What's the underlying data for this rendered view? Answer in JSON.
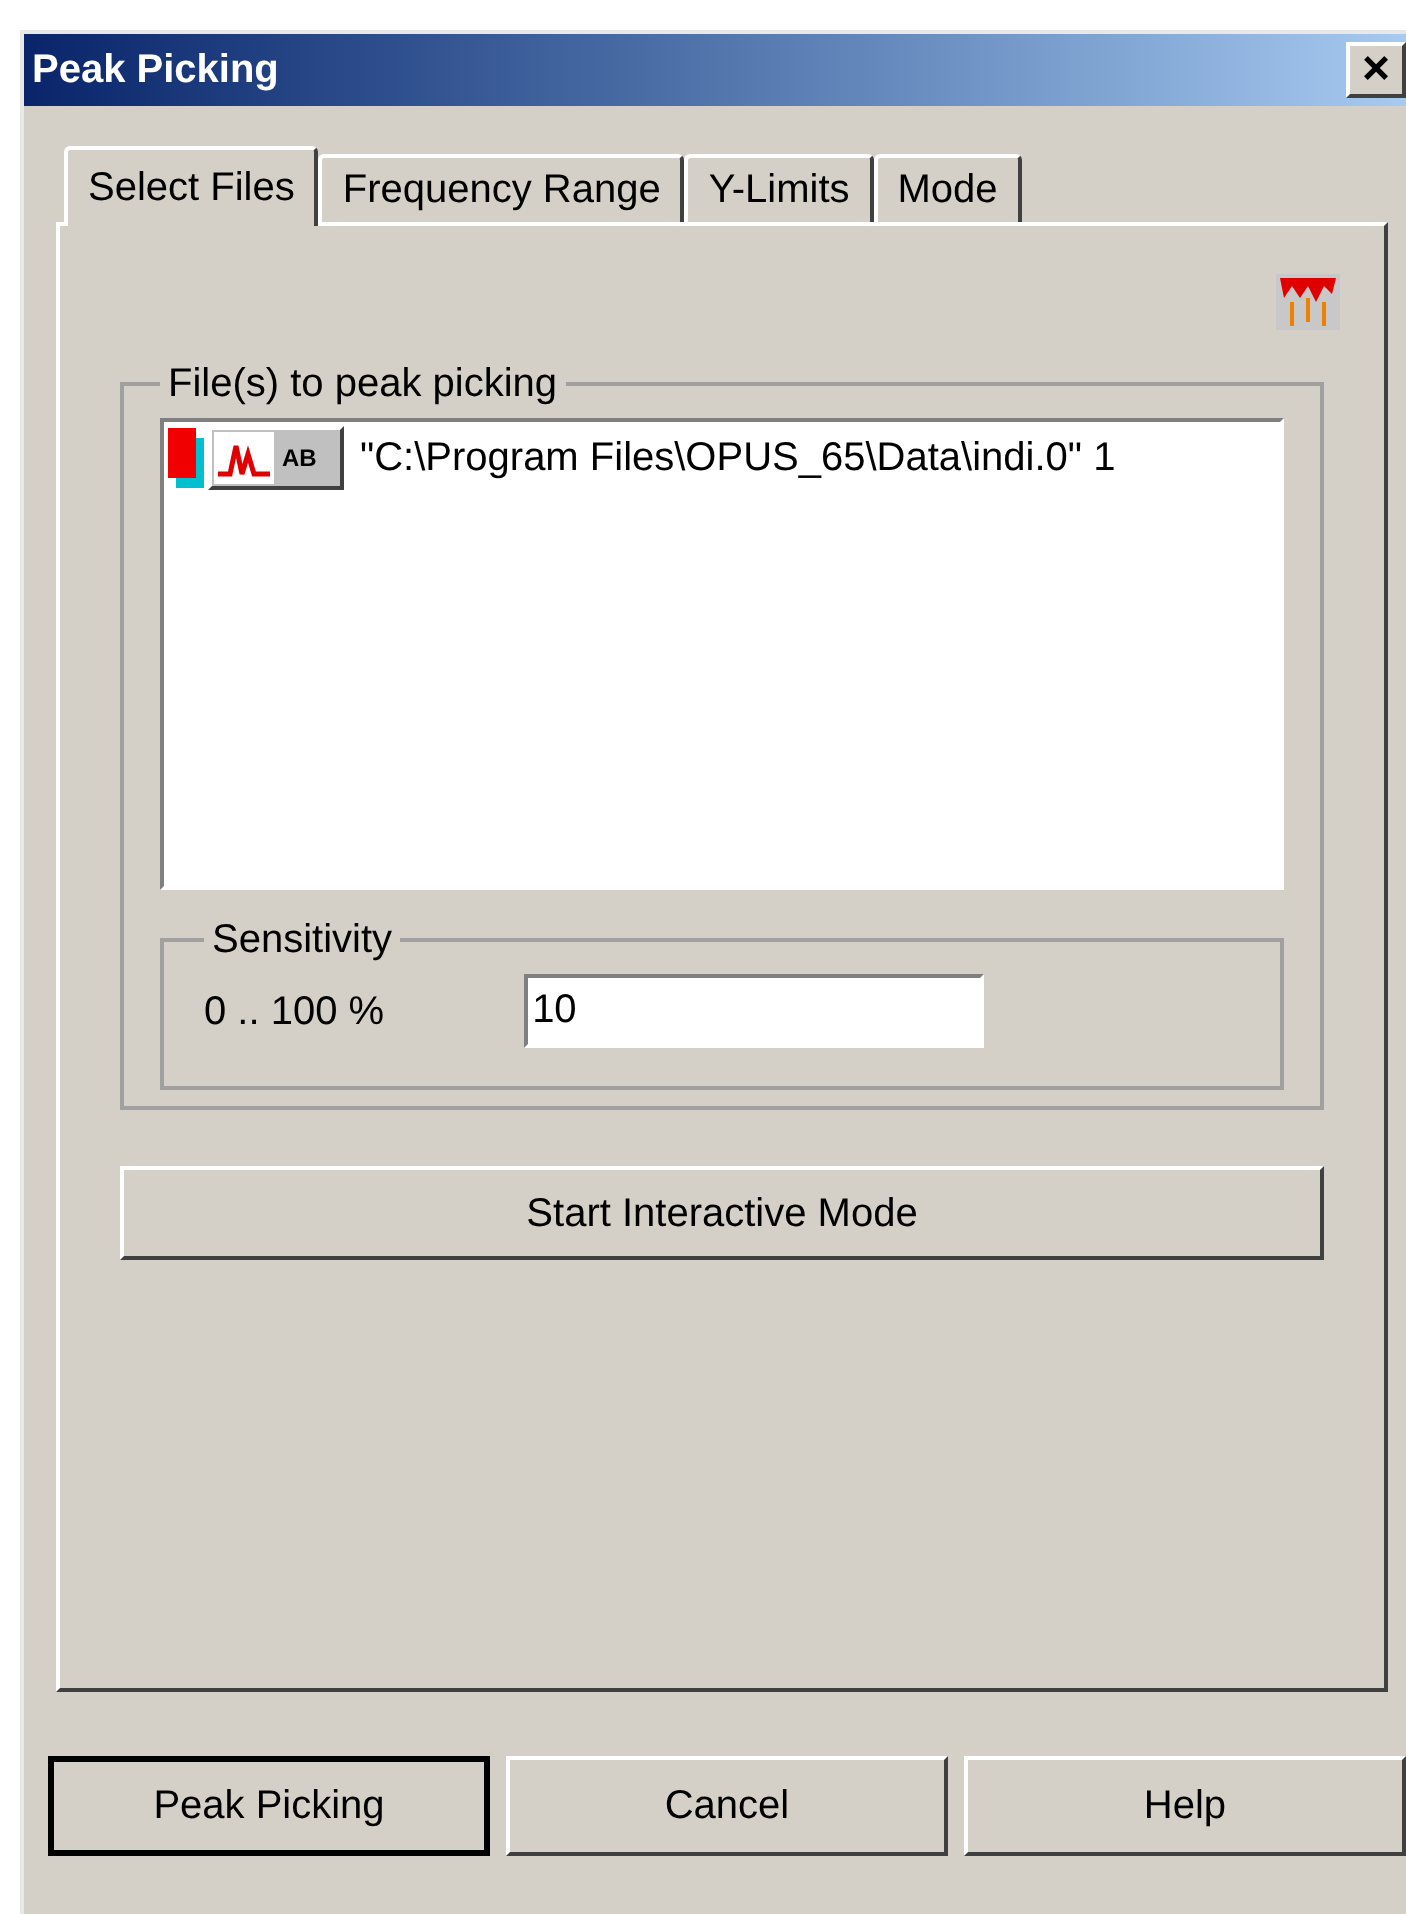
{
  "window": {
    "title": "Peak Picking",
    "close": "×"
  },
  "tabs": [
    {
      "label": "Select Files",
      "selected": true
    },
    {
      "label": "Frequency Range",
      "selected": false
    },
    {
      "label": "Y-Limits",
      "selected": false
    },
    {
      "label": "Mode",
      "selected": false
    }
  ],
  "files_group": {
    "title": "File(s) to peak picking",
    "files": [
      {
        "path": "\"C:\\Program Files\\OPUS_65\\Data\\indi.0\" 1",
        "badge": "AB"
      }
    ]
  },
  "sensitivity": {
    "title": "Sensitivity",
    "label": "0 .. 100 %",
    "value": "10"
  },
  "interactive_button": "Start Interactive Mode",
  "buttons": [
    {
      "label": "Peak Picking",
      "default": true
    },
    {
      "label": "Cancel",
      "default": false
    },
    {
      "label": "Help",
      "default": false
    }
  ]
}
